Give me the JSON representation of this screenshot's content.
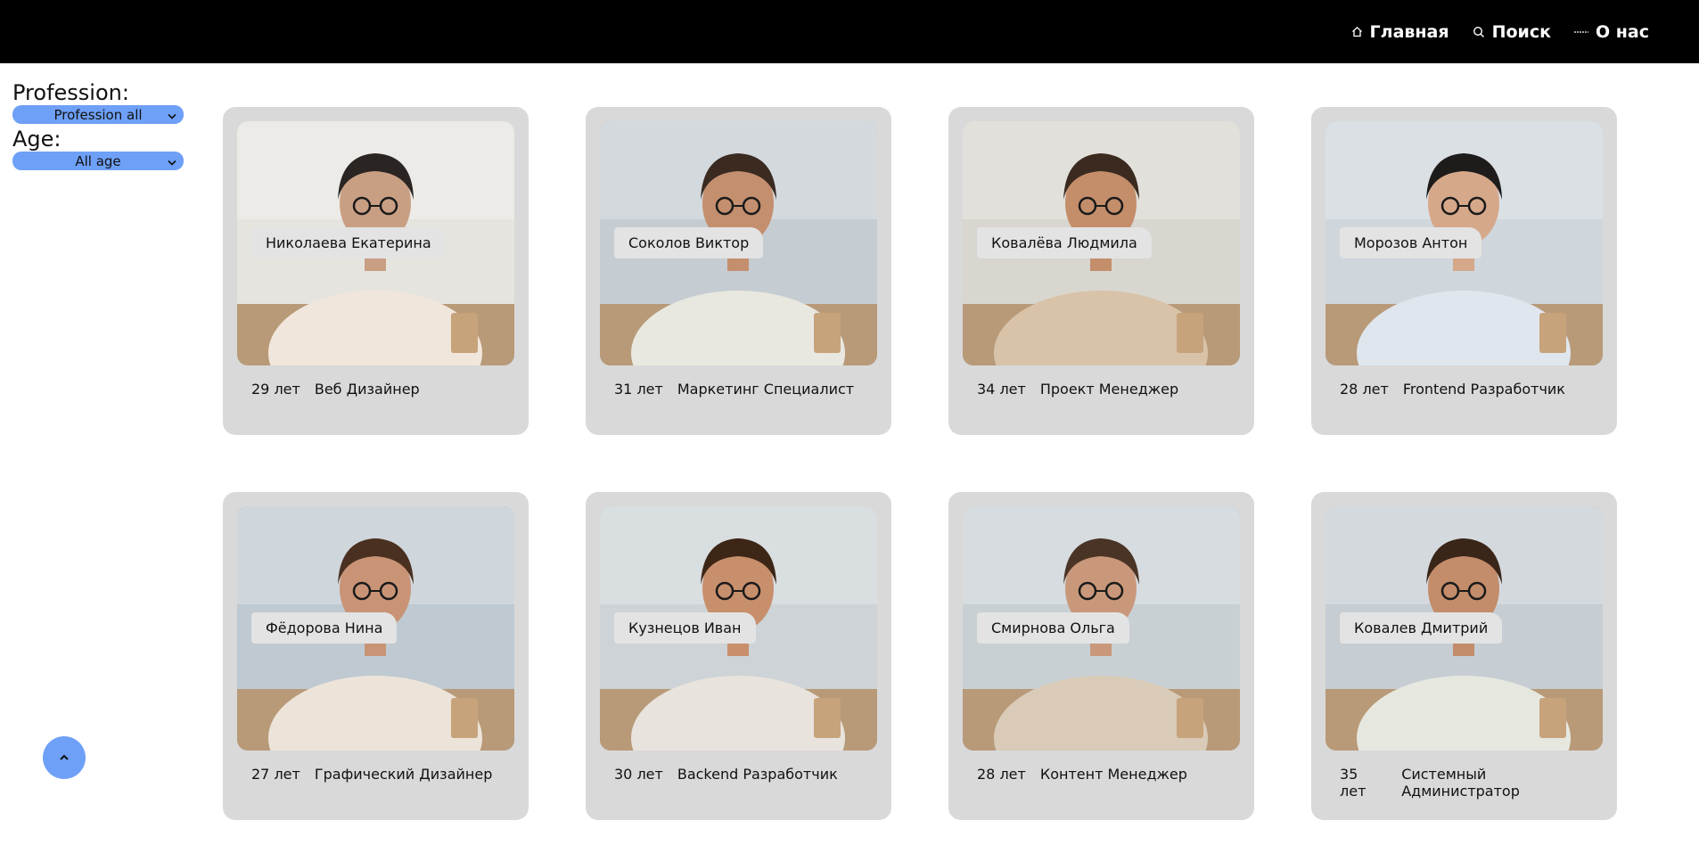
{
  "nav": {
    "items": [
      {
        "label": "Главная",
        "icon": "home-icon"
      },
      {
        "label": "Поиск",
        "icon": "search-icon"
      },
      {
        "label": "О нас",
        "icon": "info-icon"
      }
    ]
  },
  "filters": {
    "profession_label": "Profession:",
    "profession_value": "Profession all",
    "age_label": "Age:",
    "age_value": "All age"
  },
  "colors": {
    "accent": "#6ea0f7",
    "header": "#000000",
    "card": "#d9d9d9"
  },
  "cards": [
    {
      "name": "Николаева Екатерина",
      "age": "29 лет",
      "profession": "Веб Дизайнер",
      "palette": [
        "#e6e4df",
        "#2a2522",
        "#f1e6dc",
        "#c99f84"
      ]
    },
    {
      "name": "Соколов Виктор",
      "age": "31 лет",
      "profession": "Маркетинг Специалист",
      "palette": [
        "#c5ccd2",
        "#3a2a20",
        "#e8e8e0",
        "#c48f6e"
      ]
    },
    {
      "name": "Ковалёва Людмила",
      "age": "34 лет",
      "profession": "Проект Менеджер",
      "palette": [
        "#d8d6cf",
        "#3b2a1f",
        "#d8c3a8",
        "#c48e6b"
      ]
    },
    {
      "name": "Морозов Антон",
      "age": "28 лет",
      "profession": "Frontend Разработчик",
      "palette": [
        "#cfd6dc",
        "#1e1b1b",
        "#dfe6ee",
        "#d6a88a"
      ]
    },
    {
      "name": "Фёдорова Нина",
      "age": "27 лет",
      "profession": "Графический Дизайнер",
      "palette": [
        "#bfc9d1",
        "#4a3020",
        "#ece4d9",
        "#c99476"
      ]
    },
    {
      "name": "Кузнецов Иван",
      "age": "30 лет",
      "profession": "Backend Разработчик",
      "palette": [
        "#cdd3d6",
        "#3d2616",
        "#e8e3dc",
        "#c88f6c"
      ]
    },
    {
      "name": "Смирнова Ольга",
      "age": "28 лет",
      "profession": "Контент Менеджер",
      "palette": [
        "#c9d0d4",
        "#4a3426",
        "#d9cbb8",
        "#c9987b"
      ]
    },
    {
      "name": "Ковалев Дмитрий",
      "age": "35 лет",
      "profession": "Системный Администратор",
      "palette": [
        "#c6cdd3",
        "#3a2619",
        "#e6e8e0",
        "#c38c6a"
      ]
    }
  ]
}
